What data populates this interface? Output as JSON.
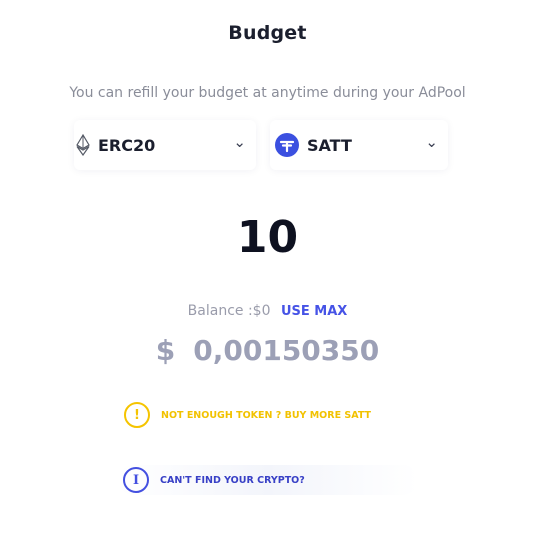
{
  "title": "Budget",
  "subtitle": "You can refill your budget at anytime during your AdPool",
  "network_select": {
    "icon": "ethereum-icon",
    "value": "ERC20"
  },
  "token_select": {
    "icon": "satt-token-icon",
    "value": "SATT"
  },
  "amount": "10",
  "balance": {
    "label": "Balance :$0",
    "use_max": "USE MAX"
  },
  "usd_value": {
    "symbol": "$",
    "value": "0,00150350"
  },
  "warning_notice": {
    "icon": "exclamation-circle-icon",
    "text": "NOT ENOUGH TOKEN ? BUY MORE SATT",
    "color": "#F5C400"
  },
  "info_notice": {
    "icon": "info-circle-icon",
    "text": "CAN'T FIND YOUR CRYPTO?",
    "color": "#4450E0"
  },
  "colors": {
    "accent": "#4653E6",
    "satt_brand": "#3B50E0"
  }
}
